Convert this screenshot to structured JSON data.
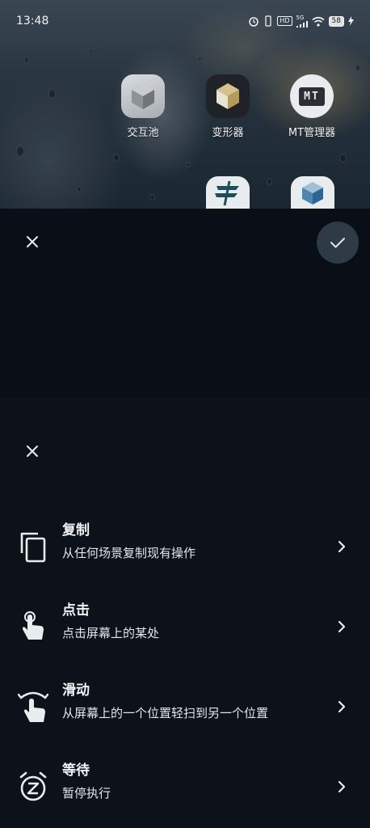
{
  "status_bar": {
    "time": "13:48",
    "network": "5G",
    "hd": "HD",
    "battery": "58"
  },
  "home_apps": [
    {
      "label": "交互池",
      "icon": "cube-icon"
    },
    {
      "label": "变形器",
      "icon": "cube-gold-icon"
    },
    {
      "label": "MT管理器",
      "icon": "mt-icon",
      "icon_text": "MT"
    }
  ],
  "overlay": {
    "close_icon": "close-icon",
    "confirm_icon": "check-icon"
  },
  "sheet": {
    "close_icon": "close-icon",
    "actions": [
      {
        "title": "复制",
        "subtitle": "从任何场景复制现有操作",
        "icon": "copy-icon"
      },
      {
        "title": "点击",
        "subtitle": "点击屏幕上的某处",
        "icon": "tap-icon"
      },
      {
        "title": "滑动",
        "subtitle": "从屏幕上的一个位置轻扫到另一个位置",
        "icon": "swipe-icon"
      },
      {
        "title": "等待",
        "subtitle": "暂停执行",
        "icon": "alarm-z-icon"
      }
    ]
  },
  "colors": {
    "sheet_bg": "#0c111a",
    "panel_bg": "#0a0e16",
    "confirm_bg": "#2e3a46",
    "text": "#f1f3f5"
  }
}
